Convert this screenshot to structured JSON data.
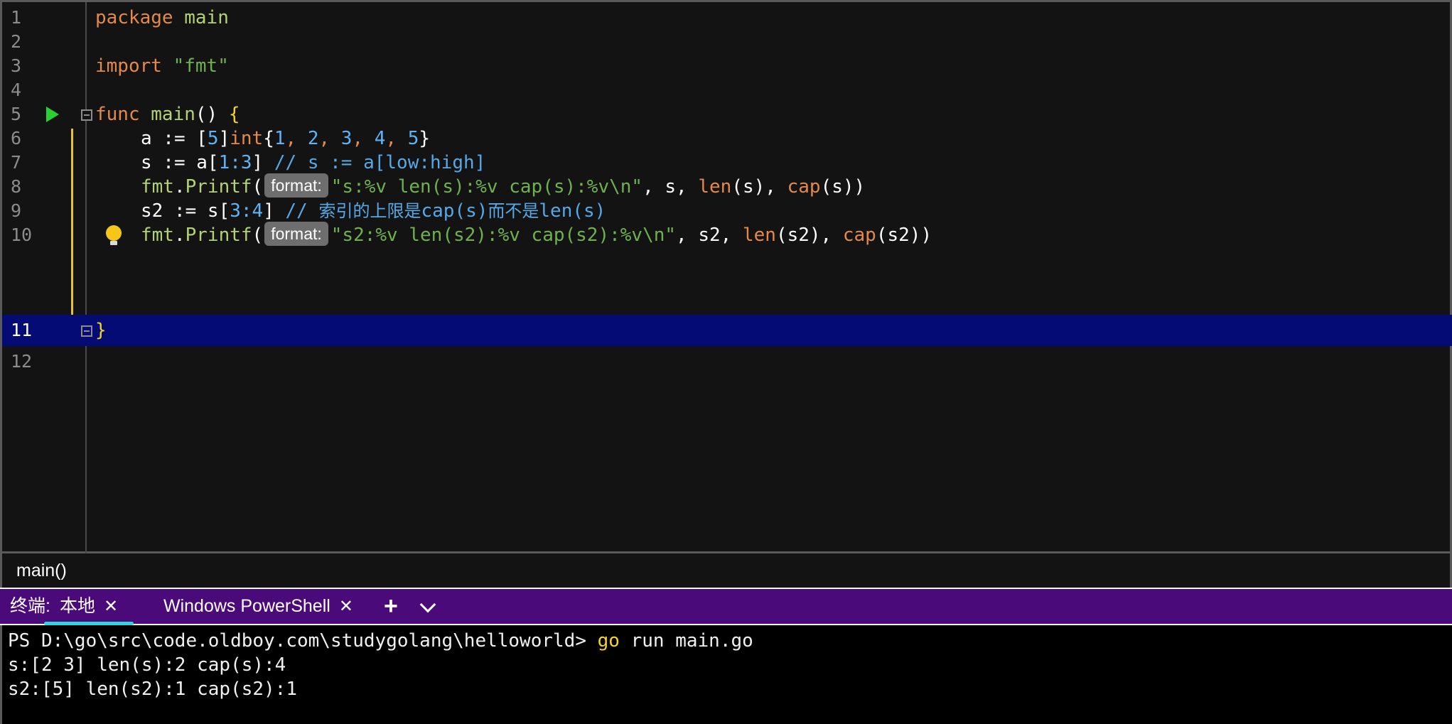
{
  "editor": {
    "line_numbers": [
      "1",
      "2",
      "3",
      "4",
      "5",
      "6",
      "7",
      "8",
      "9",
      "10",
      "11",
      "12"
    ],
    "current_line": "11",
    "lines": {
      "l1": {
        "kw": "package",
        "name": "main"
      },
      "l3": {
        "kw": "import",
        "str": "\"fmt\""
      },
      "l5": {
        "kw": "func",
        "name": "main",
        "rest": "() ",
        "brace": "{"
      },
      "l6": {
        "a": "a := [",
        "n5": "5",
        "b": "]",
        "int": "int",
        "c": "{",
        "n1": "1",
        "s1": ", ",
        "n2": "2",
        "s2": ", ",
        "n3": "3",
        "s3": ", ",
        "n4": "4",
        "s4": ", ",
        "n5b": "5",
        "d": "}"
      },
      "l7": {
        "a": "s := a[",
        "n1": "1",
        "colon": ":",
        "n3": "3",
        "b": "] ",
        "comment": "// s := a[low:high]"
      },
      "l8": {
        "fmt": "fmt",
        "dot": ".",
        "printf": "Printf",
        "open": "(",
        "hint": "format:",
        "str": "\"s:%v len(s):%v cap(s):%v\\n\"",
        "c1": ", s, ",
        "len": "len",
        "a1": "(s), ",
        "cap": "cap",
        "a2": "(s))"
      },
      "l9": {
        "a": "s2 := s[",
        "n3": "3",
        "colon": ":",
        "n4": "4",
        "b": "] ",
        "c1": "// ",
        "c2": "索引的上限是",
        "c3": "cap(s)",
        "c4": "而不是",
        "c5": "len(s)"
      },
      "l10": {
        "fmt": "fmt",
        "dot": ".",
        "printf": "Printf",
        "open": "(",
        "hint": "format:",
        "str": "\"s2:%v len(s2):%v cap(s2):%v\\n\"",
        "c1": ", s2, ",
        "len": "len",
        "a1": "(s2), ",
        "cap": "cap",
        "a2": "(s2))"
      },
      "l11": {
        "brace": "}"
      }
    }
  },
  "breadcrumb": {
    "text": "main()"
  },
  "terminal": {
    "label": "终端:",
    "tabs": [
      {
        "label": "本地",
        "active": true
      },
      {
        "label": "Windows PowerShell",
        "active": false
      }
    ],
    "add_symbol": "+",
    "prompt": "PS D:\\go\\src\\code.oldboy.com\\studygolang\\helloworld> ",
    "cmd_go": "go",
    "cmd_rest": " run main.go",
    "output": [
      "s:[2 3] len(s):2 cap(s):4",
      "s2:[5] len(s2):1 cap(s2):1"
    ]
  },
  "colors": {
    "keyword": "#e5894a",
    "function": "#b4d273",
    "string": "#6fb24d",
    "number": "#5fb3f5",
    "comment": "#56a8e6",
    "brace": "#f2d42a",
    "current_line": "#040b75",
    "tab_bar": "#4b0a7a",
    "active_tab_underline": "#2fd4e0",
    "run_icon": "#28d030",
    "bulb": "#f5c518"
  },
  "icons": [
    "run-icon",
    "fold-icon",
    "lightbulb-icon",
    "close-icon",
    "plus-icon",
    "chevron-down-icon"
  ]
}
